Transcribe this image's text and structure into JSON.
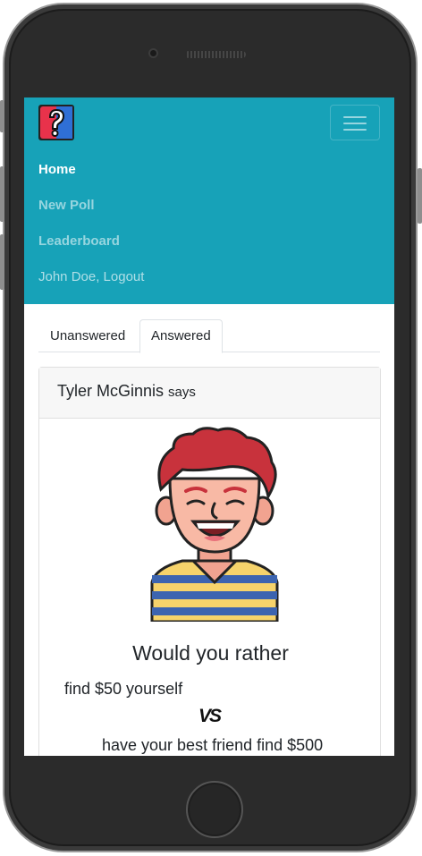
{
  "navbar": {
    "links": [
      {
        "label": "Home",
        "active": true
      },
      {
        "label": "New Poll",
        "active": false
      },
      {
        "label": "Leaderboard",
        "active": false
      }
    ],
    "user_logout_label": "John Doe, Logout",
    "accent_color": "#17a2b8"
  },
  "tabs": [
    {
      "label": "Unanswered",
      "active": false
    },
    {
      "label": "Answered",
      "active": true
    }
  ],
  "poll": {
    "author": "Tyler McGinnis",
    "says_label": "says",
    "question_title": "Would you rather",
    "option_one": "find $50 yourself",
    "vs_label": "VS",
    "option_two": "have your best friend find $500"
  },
  "icons": {
    "brand": "question-mark-icon",
    "menu": "hamburger-menu-icon",
    "avatar": "user-avatar"
  }
}
